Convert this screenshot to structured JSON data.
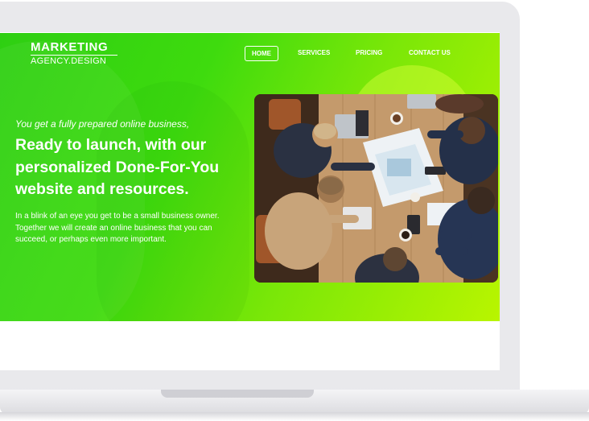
{
  "logo": {
    "line1": "MARKETING",
    "line2": "AGENCY.DESIGN"
  },
  "nav": [
    {
      "label": "HOME",
      "active": true
    },
    {
      "label": "SERVICES",
      "active": false
    },
    {
      "label": "PRICING",
      "active": false
    },
    {
      "label": "CONTACT US",
      "active": false
    }
  ],
  "hero": {
    "kicker": "You get a fully prepared online business,",
    "headline": "Ready to launch, with our personalized Done-For-You website and resources.",
    "body": "In a blink of an eye you get to be a small business owner. Together we will create an online business that you can succeed, or perhaps even more important."
  },
  "colors": {
    "gradient_start": "#2ecf12",
    "gradient_end": "#b9f500",
    "text": "#ffffff"
  },
  "photo": {
    "subject": "team-meeting-photo"
  }
}
